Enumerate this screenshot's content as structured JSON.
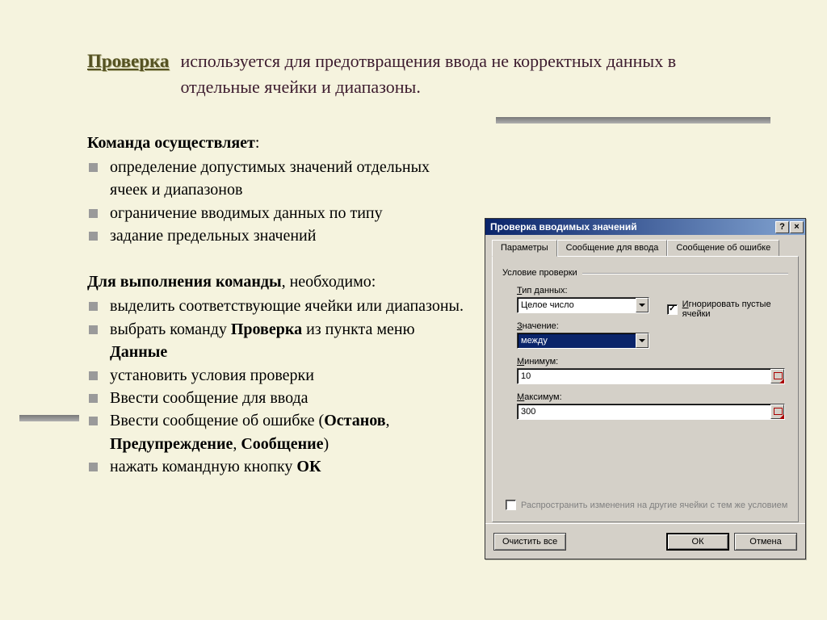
{
  "title": "Проверка",
  "subtitle": "используется для предотвращения ввода не корректных данных в отдельные ячейки и диапазоны.",
  "section1": {
    "heading": "Команда осуществляет",
    "items": [
      "определение допустимых значений отдельных ячеек и   диапазонов",
      "ограничение вводимых данных по типу",
      "задание предельных значений"
    ]
  },
  "section2": {
    "heading_pre": "Для выполнения команды",
    "heading_post": ", необходимо:",
    "items": {
      "i1": "выделить соответствующие ячейки или диапазоны.",
      "i2_pre": "выбрать команду ",
      "i2_b1": "Проверка",
      "i2_mid": " из пункта меню ",
      "i2_b2": "Данные",
      "i3": "установить условия проверки",
      "i4": "Ввести сообщение для ввода",
      "i5_pre": "Ввести сообщение об ошибке (",
      "i5_b1": "Останов",
      "i5_c1": ", ",
      "i5_b2": "Предупреждение",
      "i5_c2": ", ",
      "i5_b3": "Сообщение",
      "i5_post": ")",
      "i6_pre": "нажать командную кнопку ",
      "i6_b": "ОК"
    }
  },
  "dialog": {
    "title": "Проверка вводимых значений",
    "help_glyph": "?",
    "close_glyph": "×",
    "tabs": [
      "Параметры",
      "Сообщение для ввода",
      "Сообщение об ошибке"
    ],
    "group_label": "Условие проверки",
    "fields": {
      "type_label_pre": "Т",
      "type_label_post": "ип данных:",
      "type_value": "Целое число",
      "ignore_label_pre": "И",
      "ignore_label_post": "гнорировать пустые ячейки",
      "value_label_pre": "З",
      "value_label_post": "начение:",
      "value_value": "между",
      "min_label_pre": "М",
      "min_label_post": "инимум:",
      "min_value": "10",
      "max_label_pre": "М",
      "max_label_post": "аксимум:",
      "max_value": "300",
      "propagate_label": "Распространить изменения на другие ячейки с тем же условием"
    },
    "buttons": {
      "clear": "Очистить все",
      "ok": "ОК",
      "cancel": "Отмена"
    }
  }
}
